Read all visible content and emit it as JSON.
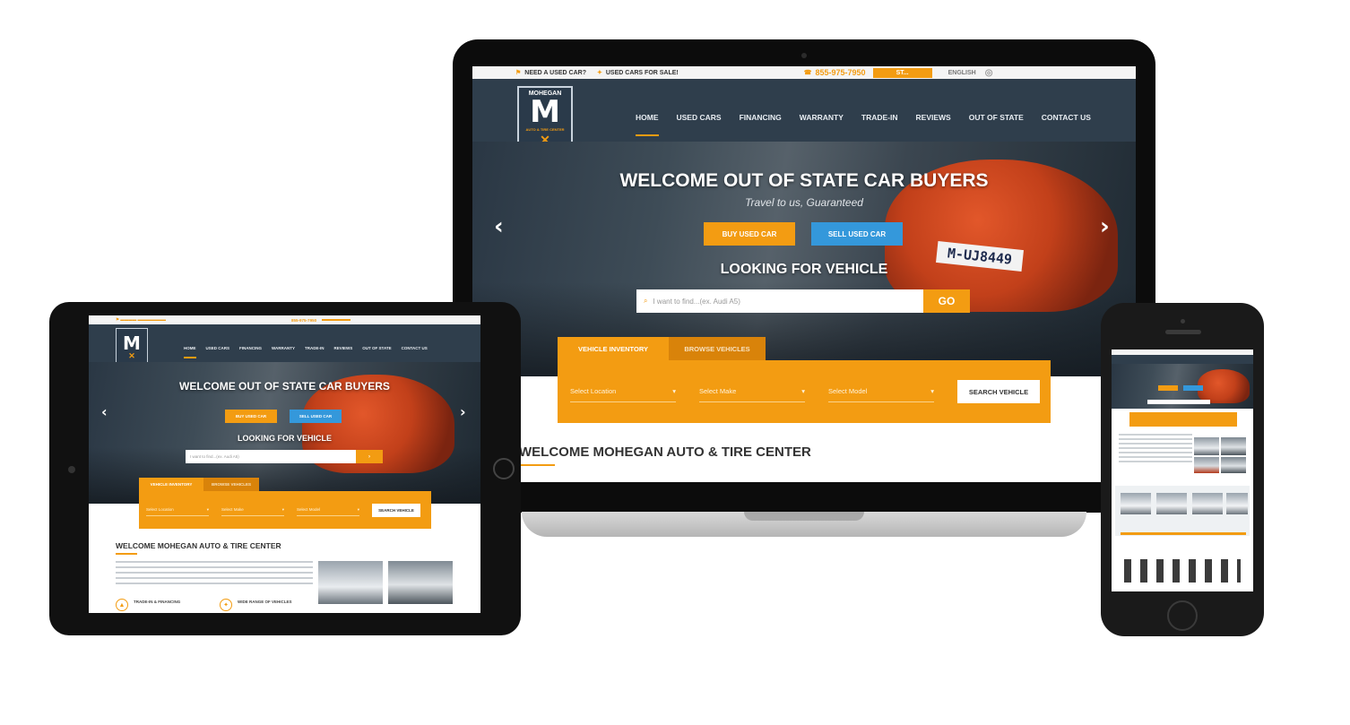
{
  "laptop": {
    "topbar": {
      "need_label": "NEED A USED CAR?",
      "count_label": "USED CARS FOR SALE!",
      "phone": "855-975-7950",
      "cta": "ST...",
      "lang": "ENGLISH"
    },
    "logo": {
      "name": "MOHEGAN",
      "letter": "M",
      "tagline": "AUTO & TIRE CENTER"
    },
    "nav": [
      "HOME",
      "USED CARS",
      "FINANCING",
      "WARRANTY",
      "TRADE-IN",
      "REVIEWS",
      "OUT OF STATE",
      "CONTACT US"
    ],
    "hero": {
      "title": "WELCOME OUT OF STATE CAR BUYERS",
      "subtitle": "Travel to us, Guaranteed",
      "buy_button": "BUY USED CAR",
      "sell_button": "SELL USED CAR",
      "plate": "M-UJ8449",
      "search_title": "LOOKING FOR VEHICLE",
      "search_placeholder": "I want to find...(ex. Audi A5)",
      "go_button": "GO",
      "prev_arrow": "‹",
      "next_arrow": "›"
    },
    "tabs": [
      "VEHICLE INVENTORY",
      "BROWSE VEHICLES"
    ],
    "filters": [
      "Select Location",
      "Select Make",
      "Select Model"
    ],
    "search_button": "SEARCH VEHICLE",
    "welcome": "WELCOME MOHEGAN AUTO & TIRE CENTER"
  },
  "tablet": {
    "phone": "855-975-7950",
    "logo_letter": "M",
    "nav": [
      "HOME",
      "USED CARS",
      "FINANCING",
      "WARRANTY",
      "TRADE-IN",
      "REVIEWS",
      "OUT OF STATE",
      "CONTACT US"
    ],
    "hero_title": "WELCOME OUT OF STATE CAR BUYERS",
    "buy_button": "BUY USED CAR",
    "sell_button": "SELL USED CAR",
    "search_title": "LOOKING FOR VEHICLE",
    "search_placeholder": "I want to find...(ex. Audi A5)",
    "tabs": [
      "VEHICLE INVENTORY",
      "BROWSE VEHICLES"
    ],
    "filters": [
      "Select Location",
      "Select Make",
      "Select Model"
    ],
    "search_button": "SEARCH VEHICLE",
    "welcome": "WELCOME MOHEGAN AUTO & TIRE CENTER",
    "feature_1": "TRADE-IN & FINANCING",
    "feature_2": "WIDE RANGE OF VEHICLES"
  },
  "colors": {
    "accent": "#f39c12",
    "header": "#2f3e4c",
    "blue": "#3498db"
  }
}
